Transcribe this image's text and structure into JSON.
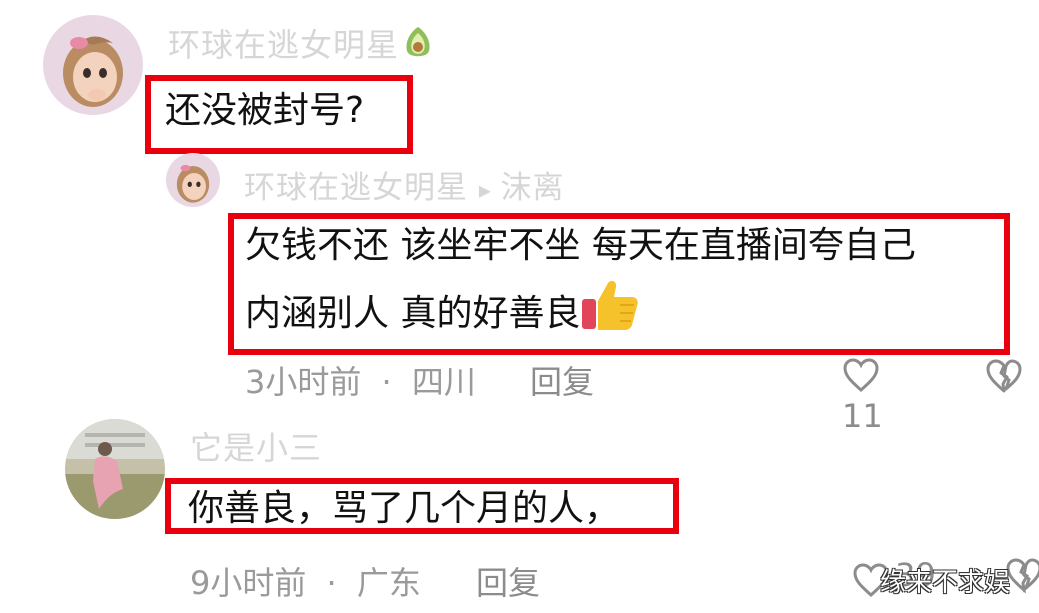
{
  "comments": [
    {
      "username": "环球在逃女明星",
      "username_icon": "avocado-icon",
      "text": "还没被封号?",
      "reply": {
        "username": "环球在逃女明星",
        "reply_to": "沫离",
        "text_line1": "欠钱不还 该坐牢不坐 每天在直播间夸自己",
        "text_line2": "内涵别人 真的好善良",
        "emoji": "thumbs-up-icon",
        "time": "3小时前",
        "separator": "·",
        "location": "四川",
        "reply_label": "回复",
        "like_count": "11"
      }
    },
    {
      "username": "它是小三",
      "text": "你善良，骂了几个月的人，",
      "time": "9小时前",
      "separator": "·",
      "location": "广东",
      "reply_label": "回复",
      "like_count": "39"
    }
  ],
  "watermark": "缘来不求娱",
  "colors": {
    "highlight": "#e8000f",
    "meta": "#9a9a9a",
    "username": "#d6d6d6"
  }
}
